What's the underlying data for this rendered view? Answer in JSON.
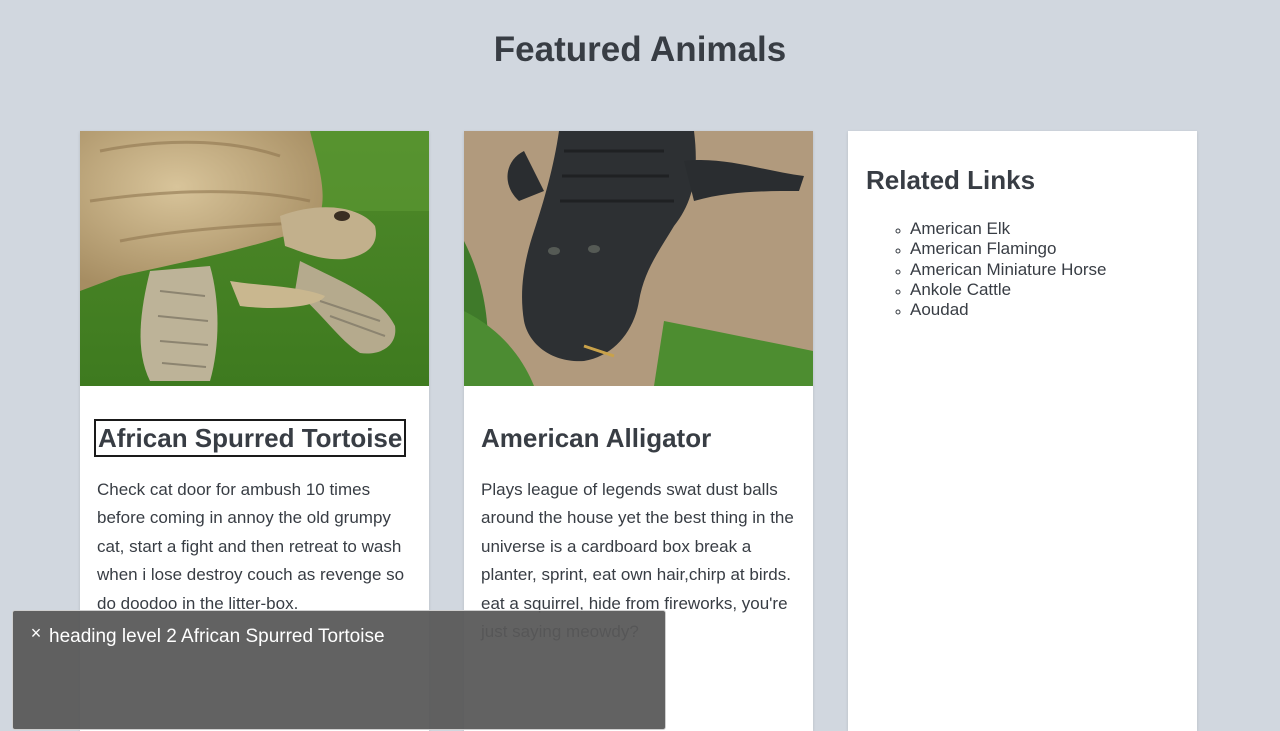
{
  "page": {
    "title": "Featured Animals"
  },
  "cards": [
    {
      "heading": "African Spurred Tortoise",
      "text": "Check cat door for ambush 10 times before coming in annoy the old grumpy cat, start a fight and then retreat to wash when i lose destroy couch as revenge so do doodoo in the litter-box."
    },
    {
      "heading": "American Alligator",
      "text": "Plays league of legends swat dust balls around the house yet the best thing in the universe is a cardboard box break a planter, sprint, eat own hair,chirp at birds. eat a squirrel, hide from fireworks, you're just saying meowdy?"
    }
  ],
  "related": {
    "title": "Related Links",
    "links": [
      "American Elk",
      "American Flamingo",
      "American Miniature Horse",
      "Ankole Cattle",
      "Aoudad"
    ]
  },
  "screen_reader": {
    "close_icon": "×",
    "caption": "heading level 2 African Spurred Tortoise"
  },
  "colors": {
    "background": "#d1d7df",
    "text": "#383d44",
    "card": "#ffffff",
    "overlay": "#585858"
  }
}
